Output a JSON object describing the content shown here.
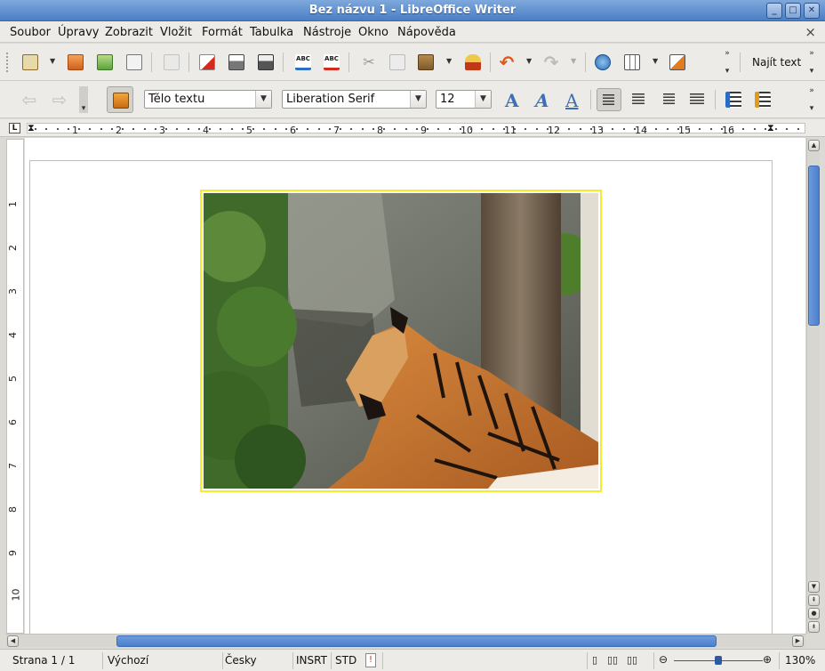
{
  "window": {
    "title": "Bez názvu 1 - LibreOffice Writer",
    "controls": [
      "minimize-icon",
      "maximize-icon",
      "close-icon"
    ]
  },
  "menu": {
    "items": [
      "Soubor",
      "Úpravy",
      "Zobrazit",
      "Vložit",
      "Formát",
      "Tabulka",
      "Nástroje",
      "Okno",
      "Nápověda"
    ],
    "close_doc": "×"
  },
  "standard_toolbar": {
    "icons": [
      "new-document-icon",
      "open-icon",
      "save-icon",
      "email-icon",
      "edit-file-icon",
      "export-pdf-icon",
      "print-icon",
      "print-preview-icon",
      "spellcheck-icon",
      "autospellcheck-icon",
      "cut-icon",
      "copy-icon",
      "paste-icon",
      "clone-formatting-icon",
      "undo-icon",
      "redo-icon",
      "hyperlink-icon",
      "table-icon",
      "draw-functions-icon"
    ],
    "find_label": "Najít text"
  },
  "formatting_toolbar": {
    "style": "Tělo textu",
    "font": "Liberation Serif",
    "size": "12",
    "font_effects": [
      "A",
      "A",
      "A"
    ]
  },
  "ruler": {
    "corner": "L",
    "numbers": [
      "1",
      "2",
      "3",
      "4",
      "5",
      "6",
      "7",
      "8",
      "9",
      "10",
      "11",
      "12",
      "13",
      "14",
      "15",
      "16"
    ],
    "vnumbers": [
      "1",
      "2",
      "3",
      "4",
      "5",
      "6",
      "7",
      "8",
      "9",
      "10"
    ]
  },
  "document": {
    "image": "tiger-photo"
  },
  "statusbar": {
    "page": "Strana 1 / 1",
    "style": "Výchozí",
    "language": "Česky",
    "insert_mode": "INSRT",
    "selection_mode": "STD",
    "zoom": "130%"
  }
}
